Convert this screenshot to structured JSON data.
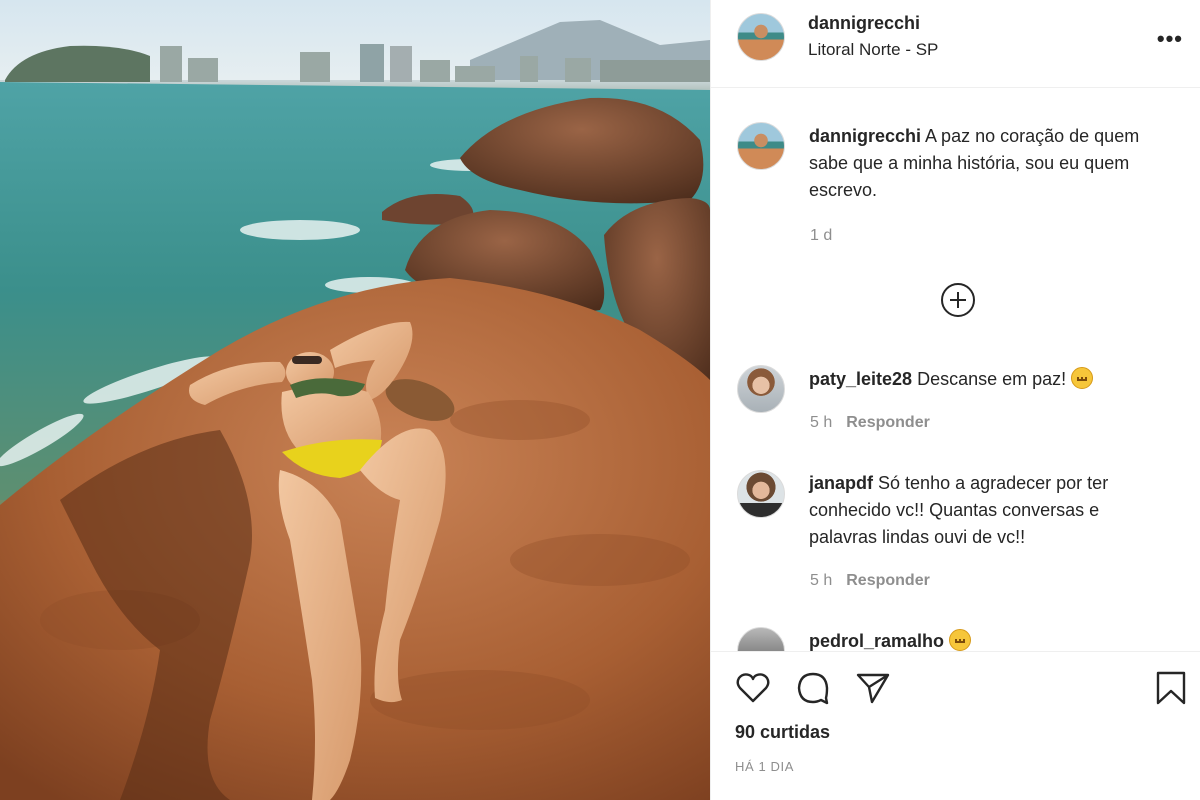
{
  "post": {
    "username": "dannigrecchi",
    "location": "Litoral Norte - SP",
    "more_icon": "more-options-icon",
    "caption_user": "dannigrecchi",
    "caption_text": "A paz no coração de quem sabe que a minha história, sou eu quem escrevo.",
    "caption_time": "1 d",
    "load_more_icon": "plus-circle-icon"
  },
  "comments": [
    {
      "user": "paty_leite28",
      "text": "Descanse em paz!",
      "emoji": "pensive-face-emoji",
      "time": "5 h",
      "reply_label": "Responder"
    },
    {
      "user": "janapdf",
      "text": "Só tenho a agradecer por ter conhecido vc!! Quantas conversas e palavras lindas ouvi de vc!!",
      "time": "5 h",
      "reply_label": "Responder"
    },
    {
      "user": "pedrol_ramalho",
      "emoji": "smiley-emoji"
    }
  ],
  "actions": {
    "like_icon": "heart-icon",
    "comment_icon": "comment-icon",
    "share_icon": "send-icon",
    "save_icon": "bookmark-icon",
    "likes_text": "90 curtidas",
    "date_text": "Há 1 dia"
  }
}
